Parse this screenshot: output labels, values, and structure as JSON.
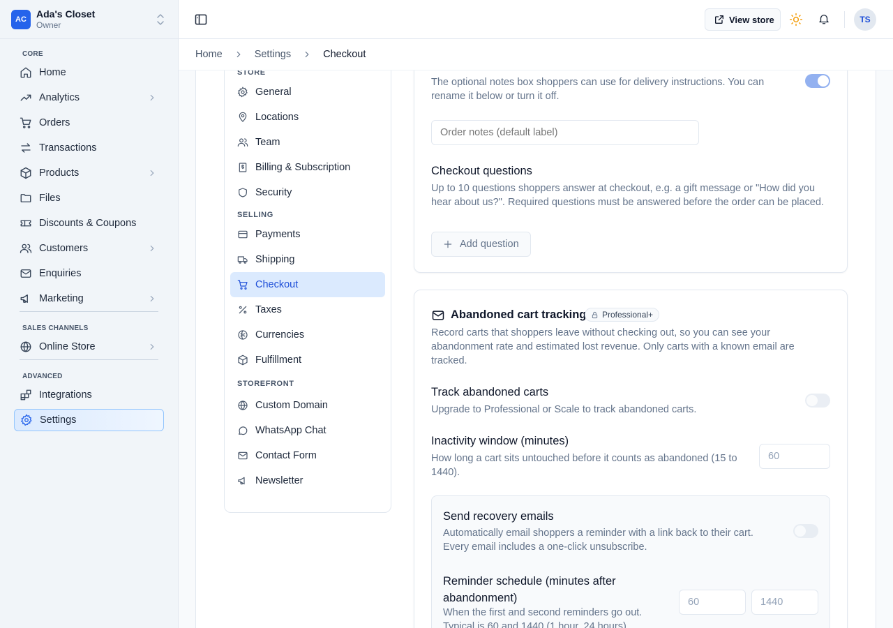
{
  "brand": {
    "initials": "AC",
    "name": "Ada's Closet",
    "role": "Owner"
  },
  "sidebar": {
    "sections": {
      "core": "CORE",
      "sales_channels": "SALES CHANNELS",
      "advanced": "ADVANCED"
    },
    "items": [
      {
        "label": "Home"
      },
      {
        "label": "Analytics"
      },
      {
        "label": "Orders"
      },
      {
        "label": "Transactions"
      },
      {
        "label": "Products"
      },
      {
        "label": "Files"
      },
      {
        "label": "Discounts & Coupons"
      },
      {
        "label": "Customers"
      },
      {
        "label": "Enquiries"
      },
      {
        "label": "Marketing"
      },
      {
        "label": "Online Store"
      },
      {
        "label": "Integrations"
      },
      {
        "label": "Settings"
      }
    ]
  },
  "topbar": {
    "view_store": "View store",
    "user_initials": "TS"
  },
  "breadcrumb": {
    "home": "Home",
    "settings": "Settings",
    "current": "Checkout"
  },
  "settings_nav": {
    "sections": {
      "store": "STORE",
      "selling": "SELLING",
      "storefront": "STOREFRONT"
    },
    "items": [
      {
        "label": "General"
      },
      {
        "label": "Locations"
      },
      {
        "label": "Team"
      },
      {
        "label": "Billing & Subscription"
      },
      {
        "label": "Security"
      },
      {
        "label": "Payments"
      },
      {
        "label": "Shipping"
      },
      {
        "label": "Checkout"
      },
      {
        "label": "Taxes"
      },
      {
        "label": "Currencies"
      },
      {
        "label": "Fulfillment"
      },
      {
        "label": "Custom Domain"
      },
      {
        "label": "WhatsApp Chat"
      },
      {
        "label": "Contact Form"
      },
      {
        "label": "Newsletter"
      }
    ]
  },
  "order_notes": {
    "description": "The optional notes box shoppers can use for delivery instructions. You can rename it below or turn it off.",
    "label_placeholder": "Order notes (default label)",
    "enabled": true
  },
  "checkout_questions": {
    "title": "Checkout questions",
    "description": "Up to 10 questions shoppers answer at checkout, e.g. a gift message or \"How did you hear about us?\". Required questions must be answered before the order can be placed.",
    "add_label": "Add question"
  },
  "abandoned_cart": {
    "title": "Abandoned cart tracking",
    "badge": "Professional+",
    "description": "Record carts that shoppers leave without checking out, so you can see your abandonment rate and estimated lost revenue. Only carts with a known email are tracked.",
    "track": {
      "title": "Track abandoned carts",
      "description": "Upgrade to Professional or Scale to track abandoned carts.",
      "enabled": false
    },
    "inactivity": {
      "title": "Inactivity window (minutes)",
      "description": "How long a cart sits untouched before it counts as abandoned (15 to 1440).",
      "value": "60"
    },
    "recovery": {
      "title": "Send recovery emails",
      "description": "Automatically email shoppers a reminder with a link back to their cart. Every email includes a one-click unsubscribe.",
      "enabled": false
    },
    "schedule": {
      "title": "Reminder schedule (minutes after abandonment)",
      "description": "When the first and second reminders go out. Typical is 60 and 1440 (1 hour, 24 hours).",
      "first": "60",
      "second": "1440"
    }
  },
  "colors": {
    "accent": "#2563eb",
    "active_bg": "#dbeafe",
    "toggle_on": "#93b1f0",
    "sun": "#f59e0b"
  }
}
